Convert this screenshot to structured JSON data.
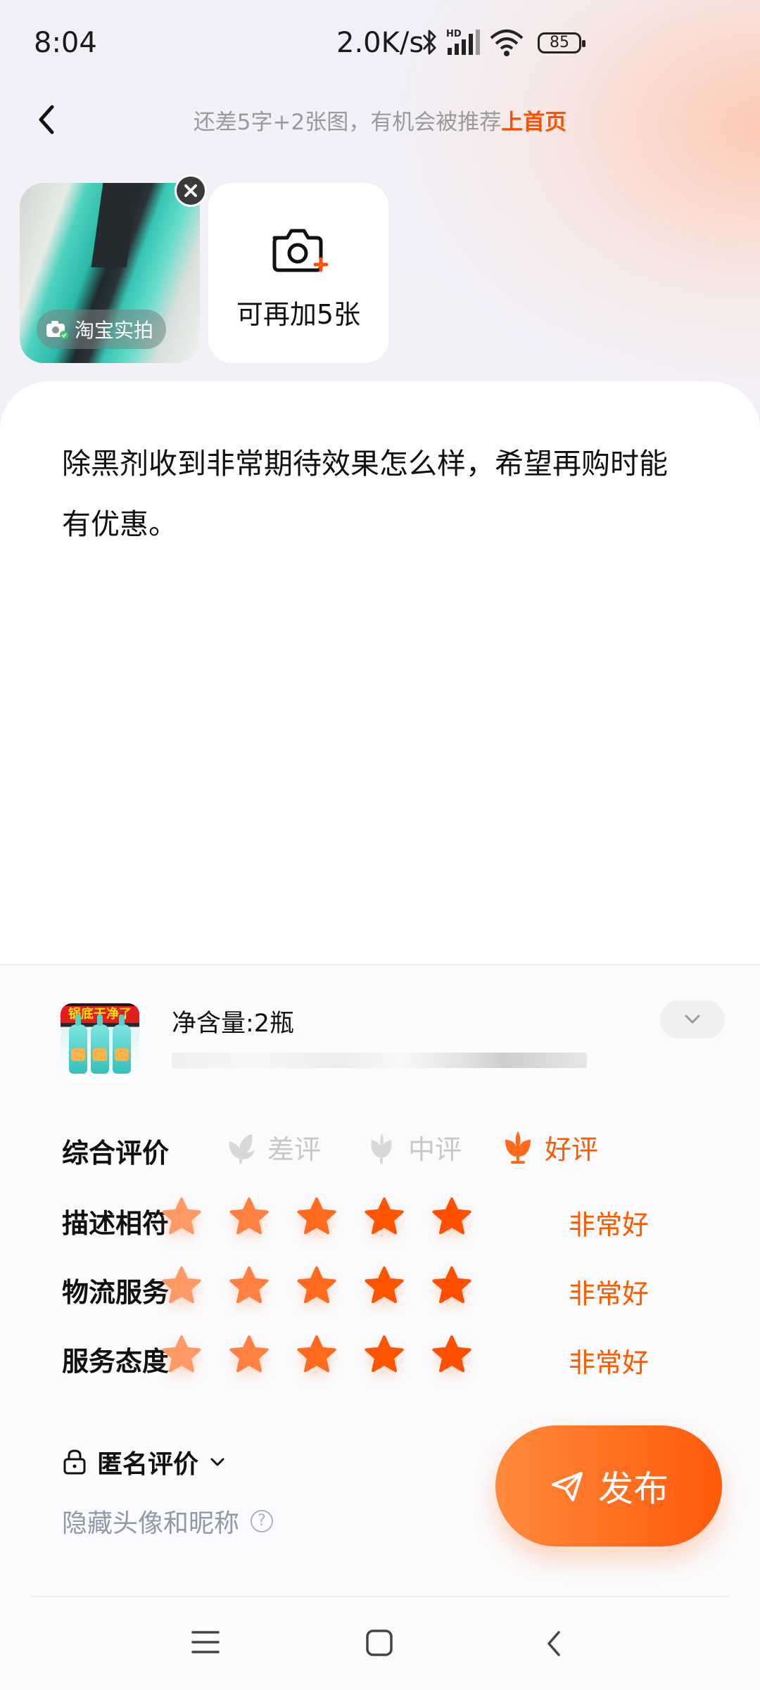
{
  "status_bar": {
    "time": "8:04",
    "net_speed": "2.0K/s",
    "battery": "85"
  },
  "header": {
    "tip_prefix": "还差5字+2张图，有机会被推荐",
    "tip_highlight": "上首页",
    "accent_color": "#ff5000"
  },
  "photos": {
    "badge_label": "淘宝实拍",
    "add_label": "可再加5张"
  },
  "review": {
    "text": "除黑剂收到非常期待效果怎么样，希望再购时能有优惠。"
  },
  "product": {
    "spec": "净含量:2瓶",
    "image_banner": "锅底干净了"
  },
  "ratings": {
    "overall_label": "综合评价",
    "options": [
      "差评",
      "中评",
      "好评"
    ],
    "selected": "好评",
    "rows": [
      {
        "label": "描述相符",
        "stars": 5,
        "desc": "非常好"
      },
      {
        "label": "物流服务",
        "stars": 5,
        "desc": "非常好"
      },
      {
        "label": "服务态度",
        "stars": 5,
        "desc": "非常好"
      }
    ]
  },
  "anonymous": {
    "label": "匿名评价",
    "sub": "隐藏头像和昵称"
  },
  "publish": {
    "label": "发布"
  }
}
